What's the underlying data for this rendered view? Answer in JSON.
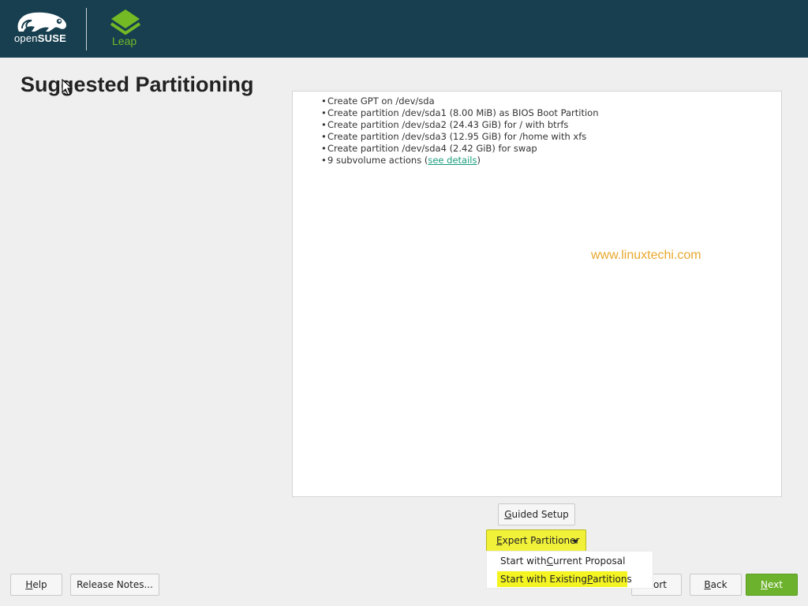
{
  "header": {
    "brand_left": "open",
    "brand_right": "SUSE",
    "product_name": "Leap",
    "brand_colors": {
      "bar": "#173f4f",
      "green": "#73ba25",
      "highlight": "#f1f13a"
    }
  },
  "page": {
    "title": "Suggested Partitioning"
  },
  "summary": {
    "items": [
      "Create GPT on /dev/sda",
      "Create partition /dev/sda1 (8.00 MiB) as BIOS Boot Partition",
      "Create partition /dev/sda2 (24.43 GiB) for / with btrfs",
      "Create partition /dev/sda3 (12.95 GiB) for /home with xfs",
      "Create partition /dev/sda4 (2.42 GiB) for swap"
    ],
    "subvolume_prefix": "9 subvolume actions (",
    "subvolume_link": "see details",
    "subvolume_suffix": ")",
    "watermark": "www.linuxtechi.com"
  },
  "partition_buttons": {
    "guided_setup": {
      "mnemonic": "G",
      "rest": "uided Setup"
    },
    "expert_partitioner": {
      "mnemonic": "E",
      "rest": "xpert Partitioner"
    }
  },
  "expert_menu": {
    "items": [
      {
        "before": "Start with ",
        "mnemonic": "C",
        "after": "urrent Proposal"
      },
      {
        "before": "Start with Existing ",
        "mnemonic": "P",
        "after": "artitions"
      }
    ]
  },
  "footer": {
    "help": {
      "mnemonic": "H",
      "rest": "elp"
    },
    "release_notes": "Release Notes...",
    "abort_visible": "bort",
    "back": {
      "mnemonic": "B",
      "rest": "ack"
    },
    "next": {
      "mnemonic": "N",
      "rest": "ext"
    }
  }
}
